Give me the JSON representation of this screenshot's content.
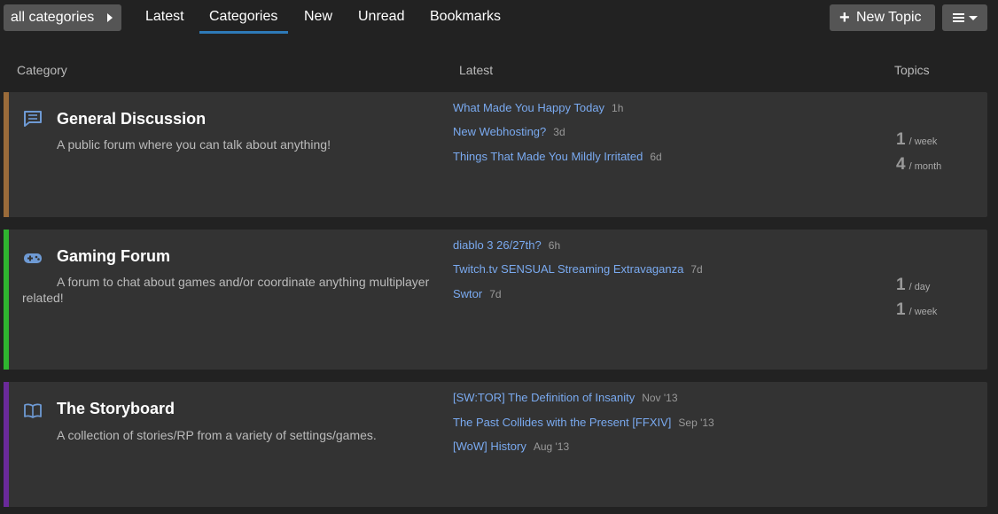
{
  "nav": {
    "category_dropdown": "all categories",
    "tabs": [
      "Latest",
      "Categories",
      "New",
      "Unread",
      "Bookmarks"
    ],
    "active_tab": "Categories",
    "new_topic": "New Topic"
  },
  "table_header": {
    "category": "Category",
    "latest": "Latest",
    "topics": "Topics"
  },
  "colors": {
    "general": "#9a6b3a",
    "gaming": "#2fb52f",
    "storyboard": "#6a2a9a",
    "link": "#7aaaf0"
  },
  "categories": [
    {
      "icon": "chat-bubble-icon",
      "title": "General Discussion",
      "description": "A public forum where you can talk about anything!",
      "topics": [
        {
          "title": "What Made You Happy Today",
          "age": "1h"
        },
        {
          "title": "New Webhosting?",
          "age": "3d"
        },
        {
          "title": "Things That Made You Mildly Irritated",
          "age": "6d"
        }
      ],
      "stats": [
        {
          "count": "1",
          "period": "/ week"
        },
        {
          "count": "4",
          "period": "/ month"
        }
      ]
    },
    {
      "icon": "gamepad-icon",
      "title": "Gaming Forum",
      "description": "A forum to chat about games and/or coordinate anything multiplayer related!",
      "topics": [
        {
          "title": "diablo 3 26/27th?",
          "age": "6h"
        },
        {
          "title": "Twitch.tv SENSUAL Streaming Extravaganza",
          "age": "7d"
        },
        {
          "title": "Swtor",
          "age": "7d"
        }
      ],
      "stats": [
        {
          "count": "1",
          "period": "/ day"
        },
        {
          "count": "1",
          "period": "/ week"
        }
      ]
    },
    {
      "icon": "book-icon",
      "title": "The Storyboard",
      "description": "A collection of stories/RP from a variety of settings/games.",
      "topics": [
        {
          "title": "[SW:TOR] The Definition of Insanity",
          "age": "Nov '13"
        },
        {
          "title": "The Past Collides with the Present [FFXIV]",
          "age": "Sep '13"
        },
        {
          "title": "[WoW] History",
          "age": "Aug '13"
        }
      ],
      "stats": []
    }
  ]
}
